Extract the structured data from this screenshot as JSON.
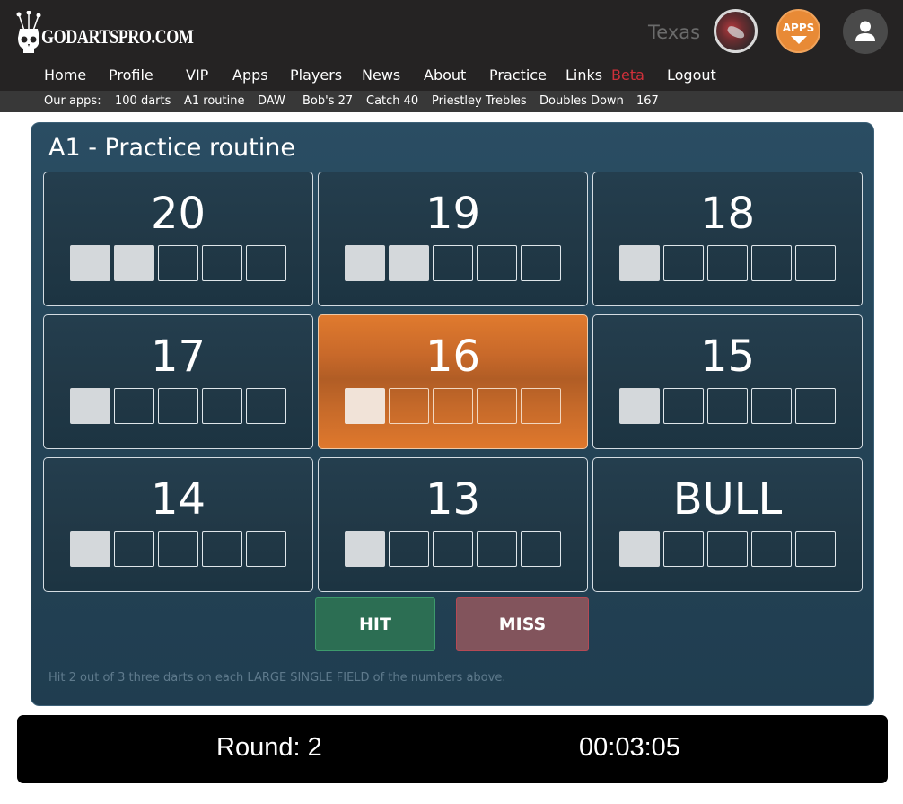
{
  "header": {
    "logo_text": "GODARTSPRO.COM",
    "user_name": "Texas",
    "apps_badge": "APPS",
    "nav": [
      {
        "label": "Home"
      },
      {
        "label": "Profile"
      },
      {
        "label": "VIP"
      },
      {
        "label": "Apps"
      },
      {
        "label": "Players"
      },
      {
        "label": "News"
      },
      {
        "label": "About"
      },
      {
        "label": "Practice"
      },
      {
        "label": "Links"
      },
      {
        "label": "Beta",
        "color": "#d0303a"
      },
      {
        "label": "Logout"
      }
    ],
    "subnav_label": "Our apps:",
    "subnav": [
      "100 darts",
      "A1 routine",
      "DAW",
      "Bob's 27",
      "Catch 40",
      "Priestley Trebles",
      "Doubles Down",
      "167"
    ]
  },
  "panel": {
    "title": "A1 - Practice routine",
    "targets": [
      {
        "label": "20",
        "filled": 2,
        "total": 5,
        "active": false
      },
      {
        "label": "19",
        "filled": 2,
        "total": 5,
        "active": false
      },
      {
        "label": "18",
        "filled": 1,
        "total": 5,
        "active": false
      },
      {
        "label": "17",
        "filled": 1,
        "total": 5,
        "active": false
      },
      {
        "label": "16",
        "filled": 1,
        "total": 5,
        "active": true
      },
      {
        "label": "15",
        "filled": 1,
        "total": 5,
        "active": false
      },
      {
        "label": "14",
        "filled": 1,
        "total": 5,
        "active": false
      },
      {
        "label": "13",
        "filled": 1,
        "total": 5,
        "active": false
      },
      {
        "label": "BULL",
        "filled": 1,
        "total": 5,
        "active": false
      }
    ],
    "hit_label": "HIT",
    "miss_label": "MISS",
    "hint": "Hit 2 out of 3 three darts on each LARGE SINGLE FIELD of the numbers above."
  },
  "status": {
    "round": "Round: 2",
    "timer": "00:03:05"
  },
  "colors": {
    "active_card": "#d8752c",
    "hit": "#2c6e53",
    "miss": "#82545c",
    "beta": "#d0303a"
  }
}
